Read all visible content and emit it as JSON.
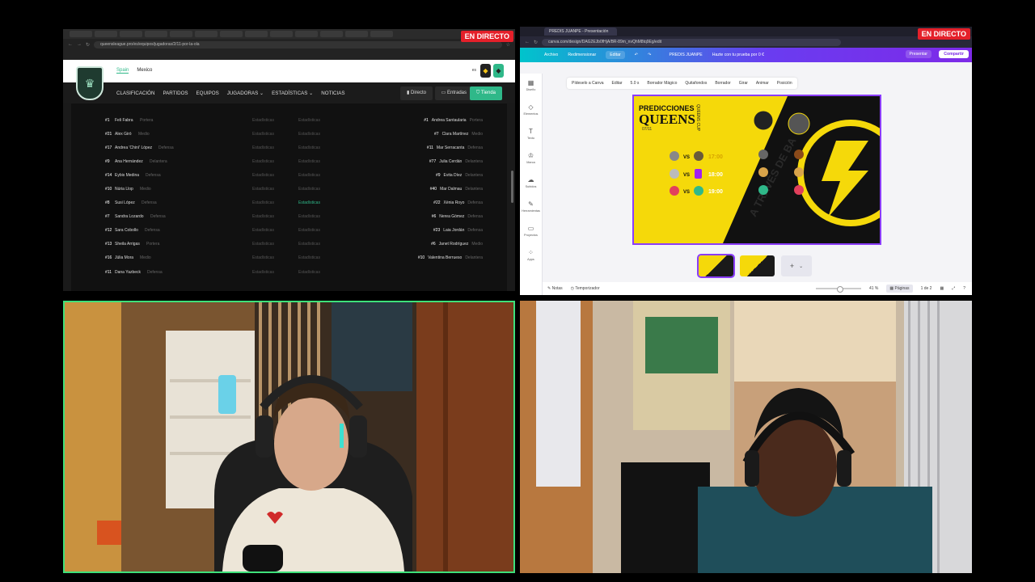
{
  "live_label": "EN DIRECTO",
  "queens": {
    "url": "queensleague.pro/es/equipos/jugadoras/2/11-por-la-ola",
    "region": [
      "Spain",
      "Mexico"
    ],
    "lang": "es",
    "nav": [
      "CLASIFICACIÓN",
      "PARTIDOS",
      "EQUIPOS",
      "JUGADORAS ⌄",
      "ESTADÍSTICAS ⌄",
      "NOTICIAS"
    ],
    "btn_directo": "Directo",
    "btn_entradas": "Entradas",
    "btn_tienda": "Tienda",
    "stats_label": "Estadísticas",
    "rows": [
      {
        "lnum": "#1",
        "lname": "Feli Fabra",
        "lpos": "Portera",
        "rnum": "#1",
        "rname": "Andrea Santaularia",
        "rpos": "Portera"
      },
      {
        "lnum": "#21",
        "lname": "Alex Giró",
        "lpos": "Medio",
        "rnum": "#7",
        "rname": "Clara Martínez",
        "rpos": "Medio"
      },
      {
        "lnum": "#17",
        "lname": "Andrea 'Chiní' López",
        "lpos": "Defensa",
        "rnum": "#11",
        "rname": "Mar Serracanta",
        "rpos": "Defensa"
      },
      {
        "lnum": "#9",
        "lname": "Ana Hernández",
        "lpos": "Delantera",
        "rnum": "#77",
        "rname": "Julia Cerdán",
        "rpos": "Delantera"
      },
      {
        "lnum": "#14",
        "lname": "Eybis Medina",
        "lpos": "Defensa",
        "rnum": "#9",
        "rname": "Evita Díez",
        "rpos": "Delantera"
      },
      {
        "lnum": "#10",
        "lname": "Núria Llop",
        "lpos": "Medio",
        "rnum": "#40",
        "rname": "Mar Dalmau",
        "rpos": "Delantera"
      },
      {
        "lnum": "#8",
        "lname": "Susi López",
        "lpos": "Defensa",
        "rnum": "#22",
        "rname": "Xènia Royo",
        "rpos": "Defensa"
      },
      {
        "lnum": "#7",
        "lname": "Sandra Lozardo",
        "lpos": "Defensa",
        "rnum": "#6",
        "rname": "Nerea Gómez",
        "rpos": "Defensa"
      },
      {
        "lnum": "#12",
        "lname": "Sara Cobollo",
        "lpos": "Defensa",
        "rnum": "#23",
        "rname": "Laia Jordán",
        "rpos": "Defensa"
      },
      {
        "lnum": "#13",
        "lname": "Sheila Arrigas",
        "lpos": "Portera",
        "rnum": "#6",
        "rname": "Janet Rodríguez",
        "rpos": "Medio"
      },
      {
        "lnum": "#16",
        "lname": "Júlia Mora",
        "lpos": "Medio",
        "rnum": "#10",
        "rname": "Valentina Berrueso",
        "rpos": "Delantera"
      },
      {
        "lnum": "#11",
        "lname": "Dana Yazbeck",
        "lpos": "Defensa",
        "rnum": "",
        "rname": "",
        "rpos": ""
      }
    ]
  },
  "canva": {
    "tab_title": "PREDIS JUANPE - Presentación",
    "url": "canva.com/design/DAG2EJb0fHjA/BR-89m_nvQhM8tq9Eg/edit",
    "menu": [
      "Archivo",
      "Redimensionar",
      "Editar"
    ],
    "doc_title": "PREDIS JUANPE",
    "try_label": "Hazte con tu prueba por 0 €",
    "present": "Presentar",
    "share": "Compartir",
    "tools": [
      "Pídeselo a Canva",
      "Editar",
      "5.0 s",
      "Borrador Mágico",
      "Quitafondos",
      "Borrador",
      "Girar",
      "Animar",
      "Posición"
    ],
    "sidebar": [
      "Diseño",
      "Elementos",
      "Texto",
      "Marca",
      "Subidos",
      "Herramientas",
      "Proyectos",
      "Apps"
    ],
    "slide": {
      "title1": "PREDICCIONES",
      "title2": "QUEENS",
      "subtitle": "QUEENS CUP",
      "date": "07/11",
      "times": [
        "17:00",
        "18:00",
        "19:00"
      ],
      "watermark": "A TRAVÉS DE BA"
    },
    "footer_notes": "Notas",
    "footer_timer": "Temporizador",
    "zoom": "41 %",
    "pages_label": "Páginas",
    "page_count": "1 de 2"
  },
  "colors": {
    "live_red": "#e4202a",
    "queens_green": "#2fb889",
    "canva_purple": "#7d2ae8",
    "slide_yellow": "#f5d90a"
  }
}
